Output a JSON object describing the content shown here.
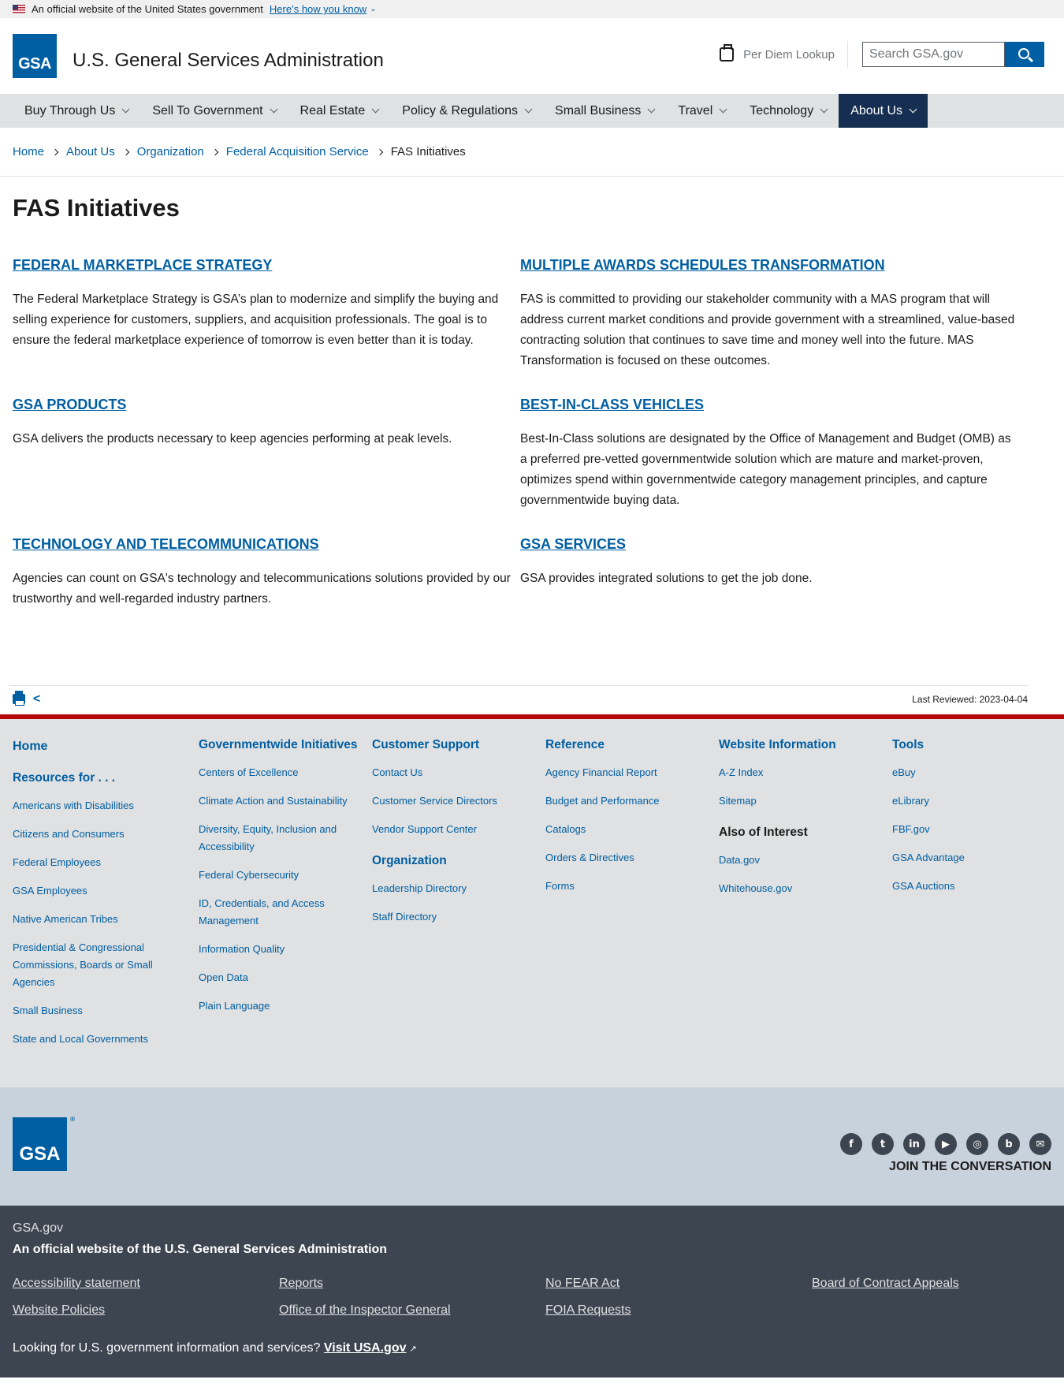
{
  "banner": {
    "text": "An official website of the United States government",
    "link": "Here’s how you know"
  },
  "header": {
    "logo": "GSA",
    "title": "U.S. General Services Administration",
    "per_diem": "Per Diem Lookup",
    "search_placeholder": "Search GSA.gov"
  },
  "nav": [
    {
      "label": "Buy Through Us"
    },
    {
      "label": "Sell To Government"
    },
    {
      "label": "Real Estate"
    },
    {
      "label": "Policy & Regulations"
    },
    {
      "label": "Small Business"
    },
    {
      "label": "Travel"
    },
    {
      "label": "Technology"
    },
    {
      "label": "About Us",
      "active": true
    }
  ],
  "breadcrumb": {
    "items": [
      "Home",
      "About Us",
      "Organization",
      "Federal Acquisition Service"
    ],
    "current": "FAS Initiatives"
  },
  "page": {
    "title": "FAS Initiatives",
    "cards": [
      {
        "title": "FEDERAL MARKETPLACE STRATEGY",
        "text": "The Federal Marketplace Strategy is GSA’s plan to modernize and simplify the buying and selling experience for customers, suppliers, and acquisition professionals. The goal is to ensure the federal marketplace experience of tomorrow is even better than it is today."
      },
      {
        "title": "MULTIPLE AWARDS SCHEDULES TRANSFORMATION",
        "text": "FAS is committed to providing our stakeholder community with a MAS program that will address current market conditions and provide government with a streamlined, value-based contracting solution that continues to save time and money well into the future. MAS Transformation is focused on these outcomes."
      },
      {
        "title": "GSA PRODUCTS",
        "text": "GSA delivers the products necessary to keep agencies performing at peak levels."
      },
      {
        "title": "BEST-IN-CLASS VEHICLES",
        "text": "Best-In-Class solutions are designated by the Office of Management and Budget (OMB) as a preferred pre-vetted governmentwide solution which are mature and market-proven, optimizes spend within governmentwide category management principles, and capture governmentwide buying data."
      },
      {
        "title": "TECHNOLOGY AND TELECOMMUNICATIONS",
        "text": "Agencies can count on GSA's technology and telecommunications solutions provided by our trustworthy and well-regarded industry partners."
      },
      {
        "title": "GSA SERVICES",
        "text": "GSA provides integrated solutions to get the job done."
      }
    ],
    "last_reviewed": "Last Reviewed: 2023-04-04"
  },
  "footer": {
    "col1": {
      "home": "Home",
      "resources_heading": "Resources for . . .",
      "links": [
        "Americans with Disabilities",
        "Citizens and Consumers",
        "Federal Employees",
        "GSA Employees",
        "Native American Tribes",
        "Presidential & Congressional Commissions, Boards or Small Agencies",
        "Small Business",
        "State and Local Governments"
      ]
    },
    "col2": {
      "heading": "Governmentwide Initiatives",
      "links": [
        "Centers of Excellence",
        "Climate Action and Sustainability",
        "Diversity, Equity, Inclusion and Accessibility",
        "Federal Cybersecurity",
        "ID, Credentials, and Access Management",
        "Information Quality",
        "Open Data",
        "Plain Language"
      ]
    },
    "col3": {
      "heading": "Customer Support",
      "links": [
        "Contact Us",
        "Customer Service Directors",
        "Vendor Support Center"
      ],
      "org_heading": "Organization",
      "org_links": [
        "Leadership Directory",
        "Staff Directory"
      ]
    },
    "col4": {
      "heading": "Reference",
      "links": [
        "Agency Financial Report",
        "Budget and Performance",
        "Catalogs",
        "Orders & Directives",
        "Forms"
      ]
    },
    "col5": {
      "heading": "Website Information",
      "links": [
        "A-Z Index",
        "Sitemap"
      ],
      "interest_heading": "Also of Interest",
      "interest_links": [
        "Data.gov",
        "Whitehouse.gov"
      ]
    },
    "col6": {
      "heading": "Tools",
      "links": [
        "eBuy",
        "eLibrary",
        "FBF.gov",
        "GSA Advantage",
        "GSA Auctions"
      ]
    },
    "logo": "GSA",
    "social_icons": [
      "facebook-icon",
      "twitter-icon",
      "linkedin-icon",
      "youtube-icon",
      "instagram-icon",
      "blog-icon",
      "email-icon"
    ],
    "join": "JOIN THE CONVERSATION",
    "site": "GSA.gov",
    "official": "An official website of the U.S. General Services Administration",
    "bottom_links": [
      "Accessibility statement",
      "Reports",
      "No FEAR Act",
      "Board of Contract Appeals",
      "Website Policies",
      "Office of the Inspector General",
      "FOIA Requests"
    ],
    "usa_text": "Looking for U.S. government information and services?",
    "usa_link": "Visit USA.gov"
  }
}
